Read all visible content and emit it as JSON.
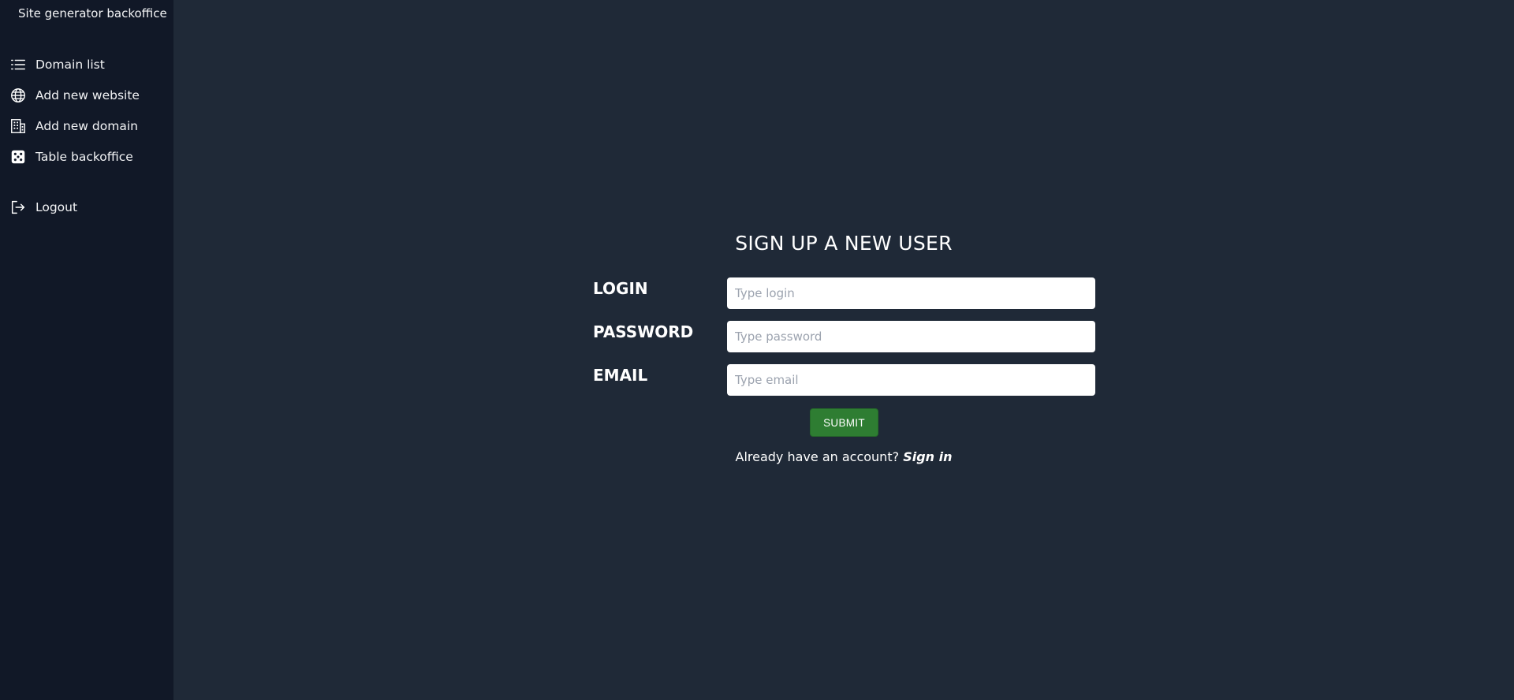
{
  "sidebar": {
    "brand": "Site generator backoffice",
    "items": [
      {
        "label": "Domain list",
        "icon": "list-icon"
      },
      {
        "label": "Add new website",
        "icon": "globe-icon"
      },
      {
        "label": "Add new domain",
        "icon": "building-icon"
      },
      {
        "label": "Table backoffice",
        "icon": "dice-icon"
      }
    ],
    "logout": {
      "label": "Logout",
      "icon": "logout-icon"
    }
  },
  "form": {
    "title": "SIGN UP A NEW USER",
    "fields": [
      {
        "label": "LOGIN",
        "placeholder": "Type login",
        "value": ""
      },
      {
        "label": "PASSWORD",
        "placeholder": "Type password",
        "value": ""
      },
      {
        "label": "EMAIL",
        "placeholder": "Type email",
        "value": ""
      }
    ],
    "submit_label": "SUBMIT",
    "signin_prompt": "Already have an account?",
    "signin_link": "Sign in"
  },
  "colors": {
    "sidebar_bg": "#111827",
    "main_bg": "#1f2937",
    "submit_bg": "#2e7d32"
  }
}
